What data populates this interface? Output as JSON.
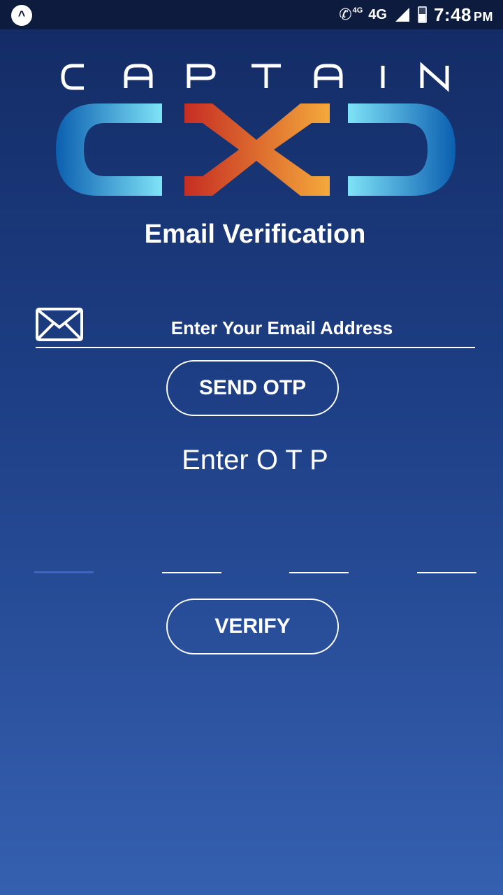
{
  "status_bar": {
    "app_icon": "^",
    "volte_tag": "4G",
    "network": "4G",
    "time": "7:48",
    "ampm": "PM",
    "icons": [
      "arrow-up-app-icon",
      "volte-call-icon",
      "signal-icon",
      "battery-icon"
    ]
  },
  "logo": {
    "wordmark": "CAPTAIN",
    "emblem": "CXD",
    "colors": {
      "blue_light": "#7fe3f7",
      "blue_dark": "#0b5fb0",
      "x_red": "#c62d23",
      "x_orange": "#f4a93b"
    }
  },
  "page": {
    "title": "Email Verification"
  },
  "email": {
    "placeholder": "Enter Your Email Address",
    "value": "",
    "icon": "envelope-icon"
  },
  "buttons": {
    "send_otp": "SEND OTP",
    "verify": "VERIFY"
  },
  "otp": {
    "label": "Enter O T P",
    "digits": [
      "",
      "",
      "",
      ""
    ],
    "active_index": 0
  },
  "colors": {
    "background_top": "#132b64",
    "background_bottom": "#3560b0",
    "status_bar": "#0d1b3e",
    "otp_active_underline": "#3d64c7"
  }
}
